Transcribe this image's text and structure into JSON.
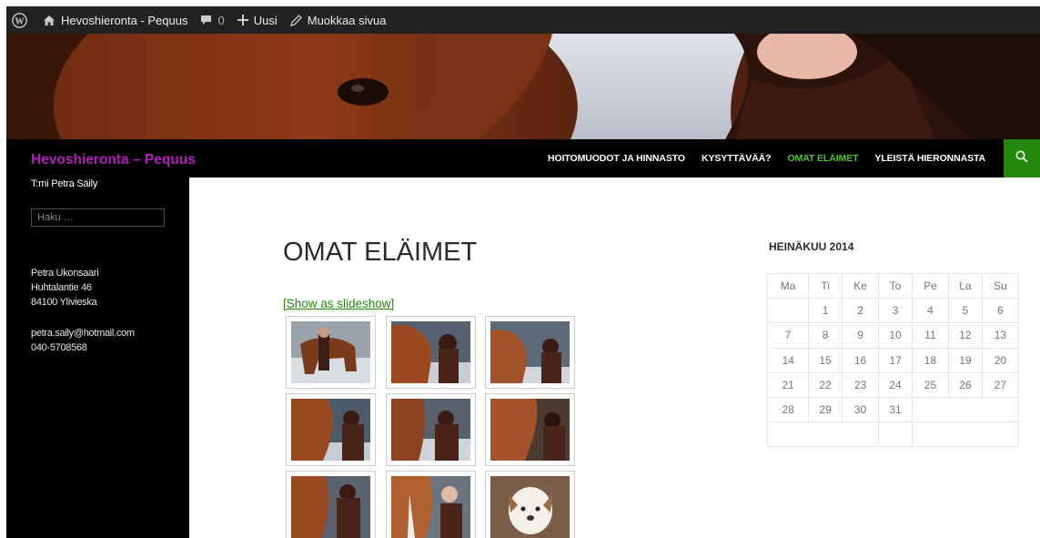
{
  "admin_bar": {
    "site_name": "Hevoshieronta - Pequus",
    "comments_count": "0",
    "new_label": "Uusi",
    "edit_label": "Muokkaa sivua"
  },
  "site": {
    "title": "Hevoshieronta – Pequus",
    "tagline": "T:mi Petra Säily"
  },
  "nav": {
    "items": [
      "HOITOMUODOT JA HINNASTO",
      "KYSYTTÄVÄÄ?",
      "OMAT ELÄIMET",
      "YLEISTÄ HIERONNASTA"
    ],
    "active_index": 2,
    "accent_color": "#24890d"
  },
  "sidebar": {
    "search_placeholder": "Haku …",
    "address_lines": [
      "Petra Ukonsaari",
      "Huhtalantie 46",
      "84100 Ylivieska"
    ],
    "email": "petra.saily@hotmail.com",
    "phone": "040-5708568"
  },
  "page": {
    "title": "OMAT ELÄIMET",
    "slideshow_link": "[Show as slideshow]"
  },
  "calendar": {
    "caption": "HEINÄKUU 2014",
    "weekdays": [
      "Ma",
      "Ti",
      "Ke",
      "To",
      "Pe",
      "La",
      "Su"
    ],
    "weeks": [
      [
        "",
        "1",
        "2",
        "3",
        "4",
        "5",
        "6"
      ],
      [
        "7",
        "8",
        "9",
        "10",
        "11",
        "12",
        "13"
      ],
      [
        "14",
        "15",
        "16",
        "17",
        "18",
        "19",
        "20"
      ],
      [
        "21",
        "22",
        "23",
        "24",
        "25",
        "26",
        "27"
      ],
      [
        "28",
        "29",
        "30",
        "31",
        "",
        "",
        ""
      ]
    ]
  },
  "colors": {
    "title_magenta": "#b01fb8",
    "link_green": "#24890d"
  }
}
